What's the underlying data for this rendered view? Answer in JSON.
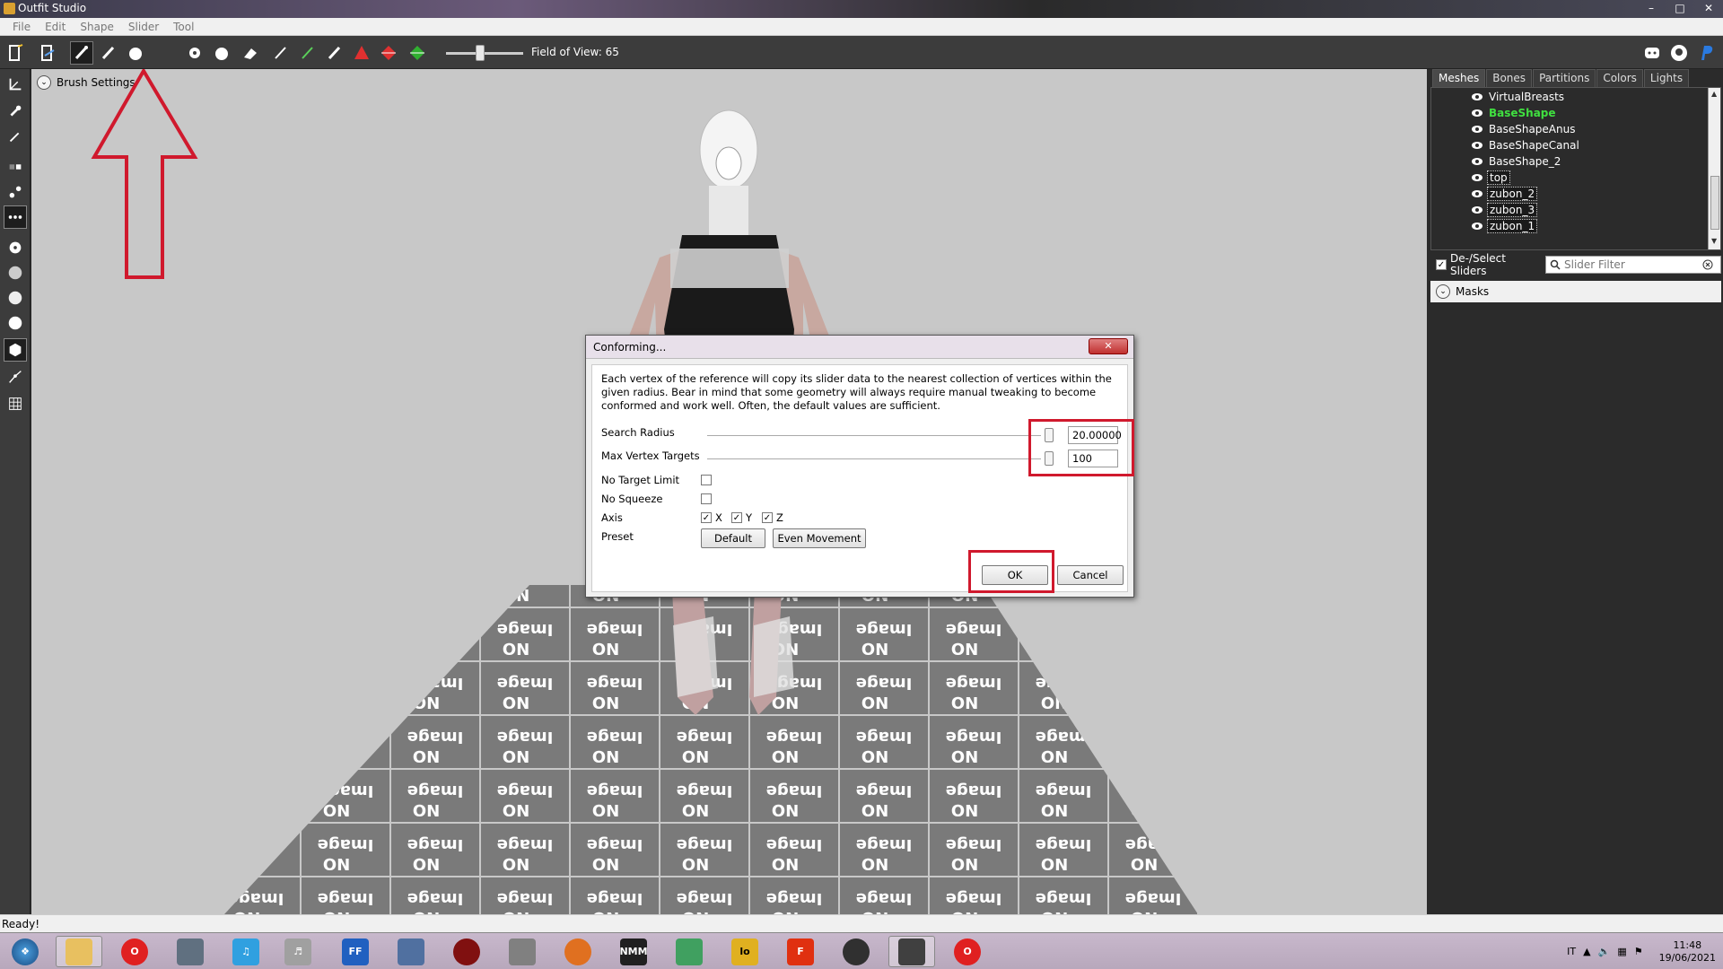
{
  "window": {
    "title": "Outfit Studio",
    "buttons": [
      "–",
      "□",
      "✕"
    ]
  },
  "menu": [
    "File",
    "Edit",
    "Shape",
    "Slider",
    "Tool"
  ],
  "toolbar": {
    "fov_label": "Field of View: 65",
    "fov_value": 65
  },
  "viewport": {
    "brush_settings_label": "Brush Settings"
  },
  "right_panel": {
    "tabs": [
      "Meshes",
      "Bones",
      "Partitions",
      "Colors",
      "Lights"
    ],
    "active_tab": "Meshes",
    "meshes": [
      {
        "name": "VirtualBreasts",
        "style": "normal"
      },
      {
        "name": "BaseShape",
        "style": "green"
      },
      {
        "name": "BaseShapeAnus",
        "style": "normal"
      },
      {
        "name": "BaseShapeCanal",
        "style": "normal"
      },
      {
        "name": "BaseShape_2",
        "style": "normal"
      },
      {
        "name": "top",
        "style": "boxed"
      },
      {
        "name": "zubon_2",
        "style": "boxed"
      },
      {
        "name": "zubon_3",
        "style": "boxed"
      },
      {
        "name": "zubon_1",
        "style": "boxed"
      }
    ],
    "deselect_label": "De-/Select Sliders",
    "slider_filter_placeholder": "Slider Filter",
    "masks_label": "Masks"
  },
  "status": {
    "text": "Ready!"
  },
  "dialog": {
    "title": "Conforming...",
    "close_label": "✕",
    "description": "Each vertex of the reference will copy its slider data to the nearest collection of vertices within the given radius. Bear in mind that some geometry will always require manual tweaking to become conformed and work well. Often, the default values are sufficient.",
    "search_radius_label": "Search Radius",
    "search_radius_value": "20.00000",
    "max_vertex_label": "Max Vertex Targets",
    "max_vertex_value": "100",
    "no_target_limit_label": "No Target Limit",
    "no_target_limit_checked": false,
    "no_squeeze_label": "No Squeeze",
    "no_squeeze_checked": false,
    "axis_label": "Axis",
    "axis": [
      {
        "name": "X",
        "checked": true
      },
      {
        "name": "Y",
        "checked": true
      },
      {
        "name": "Z",
        "checked": true
      }
    ],
    "preset_label": "Preset",
    "preset_default": "Default",
    "preset_even": "Even Movement",
    "ok_label": "OK",
    "cancel_label": "Cancel"
  },
  "taskbar": {
    "clock_time": "11:48",
    "clock_date": "19/06/2021",
    "language": "IT",
    "apps": [
      "start-orb",
      "explorer",
      "opera",
      "media-center",
      "music",
      "speaker",
      "ffdec",
      "feather",
      "spider",
      "chess",
      "audio-headphones",
      "nmm",
      "notes",
      "loot",
      "f-app",
      "creation-kit",
      "outfit-studio",
      "opera-active"
    ]
  },
  "colors": {
    "accent_red": "#d0192d",
    "mesh_green": "#40e040"
  }
}
